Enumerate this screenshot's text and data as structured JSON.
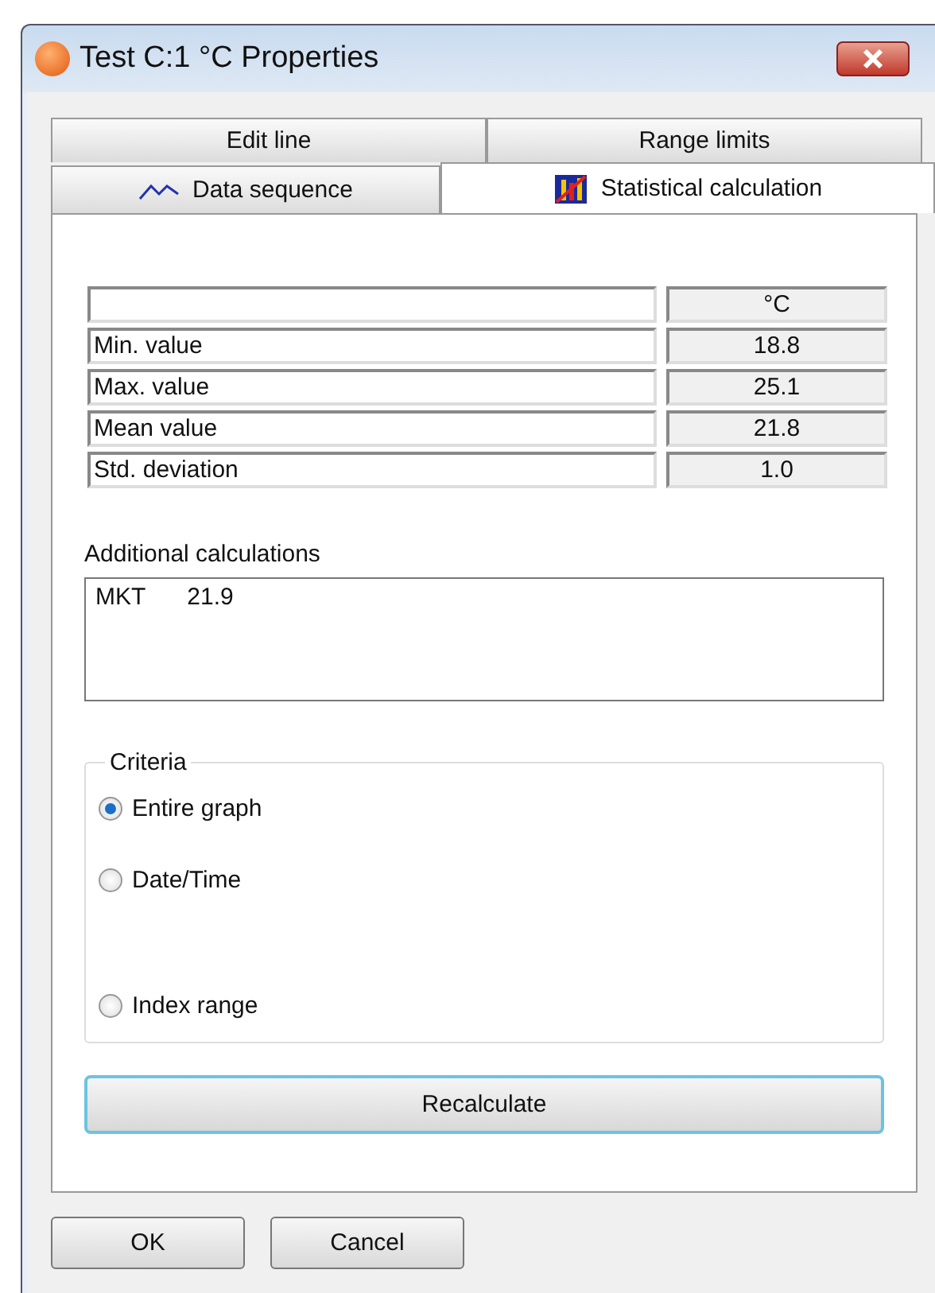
{
  "window": {
    "title": "Test C:1 °C Properties"
  },
  "tab_rows": [
    {
      "tabs": [
        {
          "label": "Edit line",
          "selected": false
        },
        {
          "label": "Range limits",
          "selected": false
        }
      ]
    },
    {
      "tabs": [
        {
          "label": "Data sequence",
          "selected": false
        },
        {
          "label": "Statistical calculation",
          "selected": true
        }
      ]
    }
  ],
  "statistics_table": {
    "columns": [
      "",
      "°C"
    ],
    "rows": [
      {
        "label": "Min. value",
        "value": "18.8"
      },
      {
        "label": "Max. value",
        "value": "25.1"
      },
      {
        "label": "Mean value",
        "value": "21.8"
      },
      {
        "label": "Std. deviation",
        "value": "1.0"
      }
    ]
  },
  "additional_calculations": {
    "label": "Additional calculations",
    "entries": [
      {
        "name": "MKT",
        "value": "21.9"
      }
    ]
  },
  "criteria": {
    "title": "Criteria",
    "options": [
      {
        "label": "Entire graph",
        "selected": true
      },
      {
        "label": "Date/Time",
        "selected": false
      },
      {
        "label": "Index range",
        "selected": false
      }
    ]
  },
  "recalculate_button": "Recalculate",
  "buttons": [
    "OK",
    "Cancel"
  ]
}
